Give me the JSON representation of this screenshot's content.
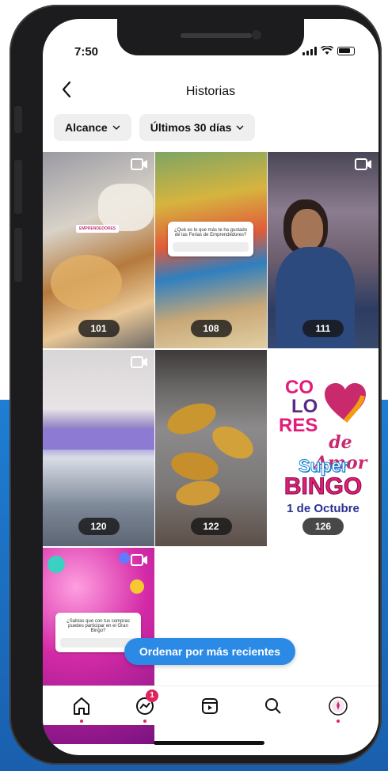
{
  "status": {
    "time": "7:50"
  },
  "header": {
    "title": "Historias"
  },
  "filters": [
    {
      "label": "Alcance"
    },
    {
      "label": "Últimos 30 días"
    }
  ],
  "stories": [
    {
      "views": "101",
      "type": "video",
      "sticker_text": ""
    },
    {
      "views": "108",
      "type": "image",
      "sticker_text": "¿Qué es lo que más te ha gustado de las Ferias de Emprendedores?"
    },
    {
      "views": "111",
      "type": "video",
      "sticker_text": ""
    },
    {
      "views": "120",
      "type": "video",
      "sticker_text": ""
    },
    {
      "views": "122",
      "type": "image",
      "sticker_text": ""
    },
    {
      "views": "126",
      "type": "image",
      "sticker_text": ""
    },
    {
      "views": "",
      "type": "video",
      "sticker_text": "¿Sabías que con tus compras puedes participar en el Gran Bingo?"
    }
  ],
  "bingo": {
    "line1": "CO",
    "line2": "LO",
    "line3": "RES",
    "line4": "de Amor",
    "line5": "Super",
    "line6": "BINGO",
    "line7": "1 de Octubre"
  },
  "sort_button": {
    "label": "Ordenar por más recientes"
  },
  "tabs": [
    {
      "icon": "home-icon"
    },
    {
      "icon": "activity-icon",
      "badge": "1"
    },
    {
      "icon": "reels-icon"
    },
    {
      "icon": "search-icon"
    },
    {
      "icon": "profile-icon"
    }
  ],
  "colors": {
    "accent": "#2b8ae6",
    "badge": "#e0245e",
    "background_blue": "#1e7ed3"
  }
}
